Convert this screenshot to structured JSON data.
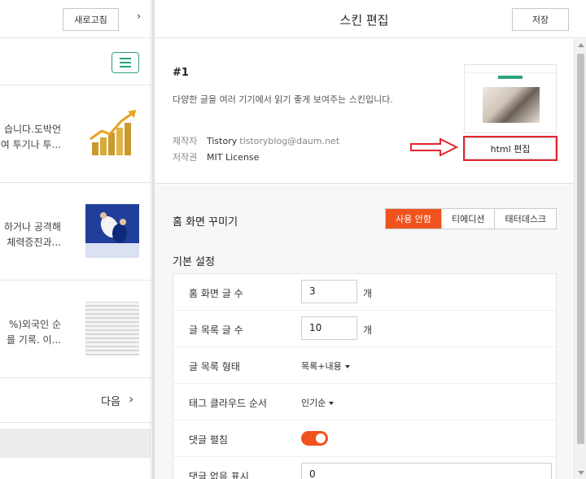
{
  "left_panel": {
    "refresh_label": "새로고침",
    "collapse_arrow": "›",
    "posts": [
      {
        "line1": "습니다.도박언",
        "line2": "여 투기나 투..."
      },
      {
        "line1": "하거나 공격해",
        "line2": "체력증진과..."
      },
      {
        "line1": "%)외국인 순",
        "line2": "를 기록. 이..."
      }
    ],
    "next_label": "다음",
    "next_arrow": "›"
  },
  "header": {
    "title": "스킨 편집",
    "save_label": "저장"
  },
  "skin": {
    "number": "#1",
    "description": "다양한 글을 여러 기기에서 읽기 좋게 보여주는 스킨입니다.",
    "maker_key": "제작자",
    "maker_name": "Tistory",
    "maker_email": "tistoryblog@daum.net",
    "license_key": "저작권",
    "license_value": "MIT License",
    "html_edit_label": "html 편집"
  },
  "home_decoration": {
    "title": "홈 화면 꾸미기",
    "options": [
      "사용 안함",
      "티에디션",
      "태터데스크"
    ],
    "selected": "사용 안함"
  },
  "basic_settings": {
    "title": "기본 설정",
    "rows": {
      "home_count_label": "홈 화면 글 수",
      "home_count_value": "3",
      "home_count_unit": "개",
      "list_count_label": "글 목록 글 수",
      "list_count_value": "10",
      "list_count_unit": "개",
      "list_type_label": "글 목록 형태",
      "list_type_value": "목록+내용",
      "tag_order_label": "태그 클라우드 순서",
      "tag_order_value": "인기순",
      "comment_expand_label": "댓글 펼침",
      "comment_expand_on": true,
      "no_comment_label": "댓글 없음 표시",
      "no_comment_value": "0"
    }
  },
  "colors": {
    "accent": "#f0521e",
    "green": "#2aa37d",
    "annotation_red": "#e3262d"
  }
}
